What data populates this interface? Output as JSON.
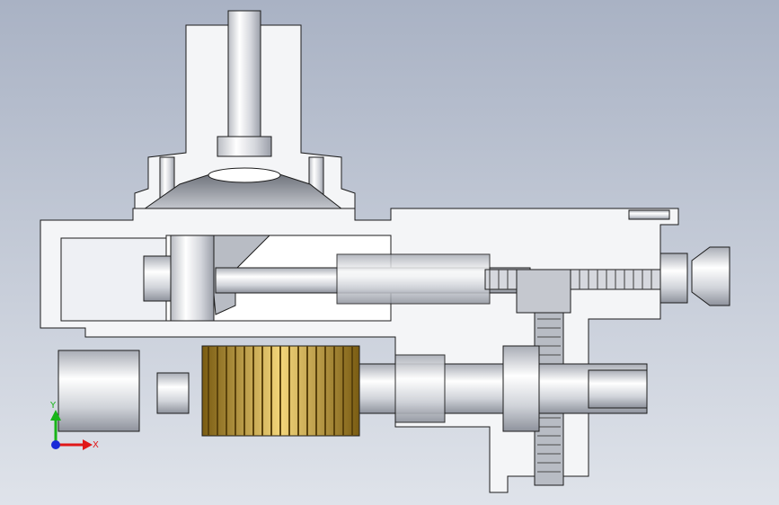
{
  "viewport": {
    "background_top": "#a9b2c4",
    "background_bottom": "#dfe3ea"
  },
  "triad": {
    "x_label": "X",
    "y_label": "Y",
    "x_color": "#e01818",
    "y_color": "#18b418",
    "z_color": "#1a2ad8"
  },
  "model": {
    "housing_color": "#f4f5f7",
    "section_color": "#ffffff",
    "outline_color": "#1c1c1c",
    "shaft_color": "#d9dbe0",
    "hob_color": "#d9b24a",
    "hob_dark_color": "#8a6a18",
    "gear_color": "#b8bcc4"
  }
}
